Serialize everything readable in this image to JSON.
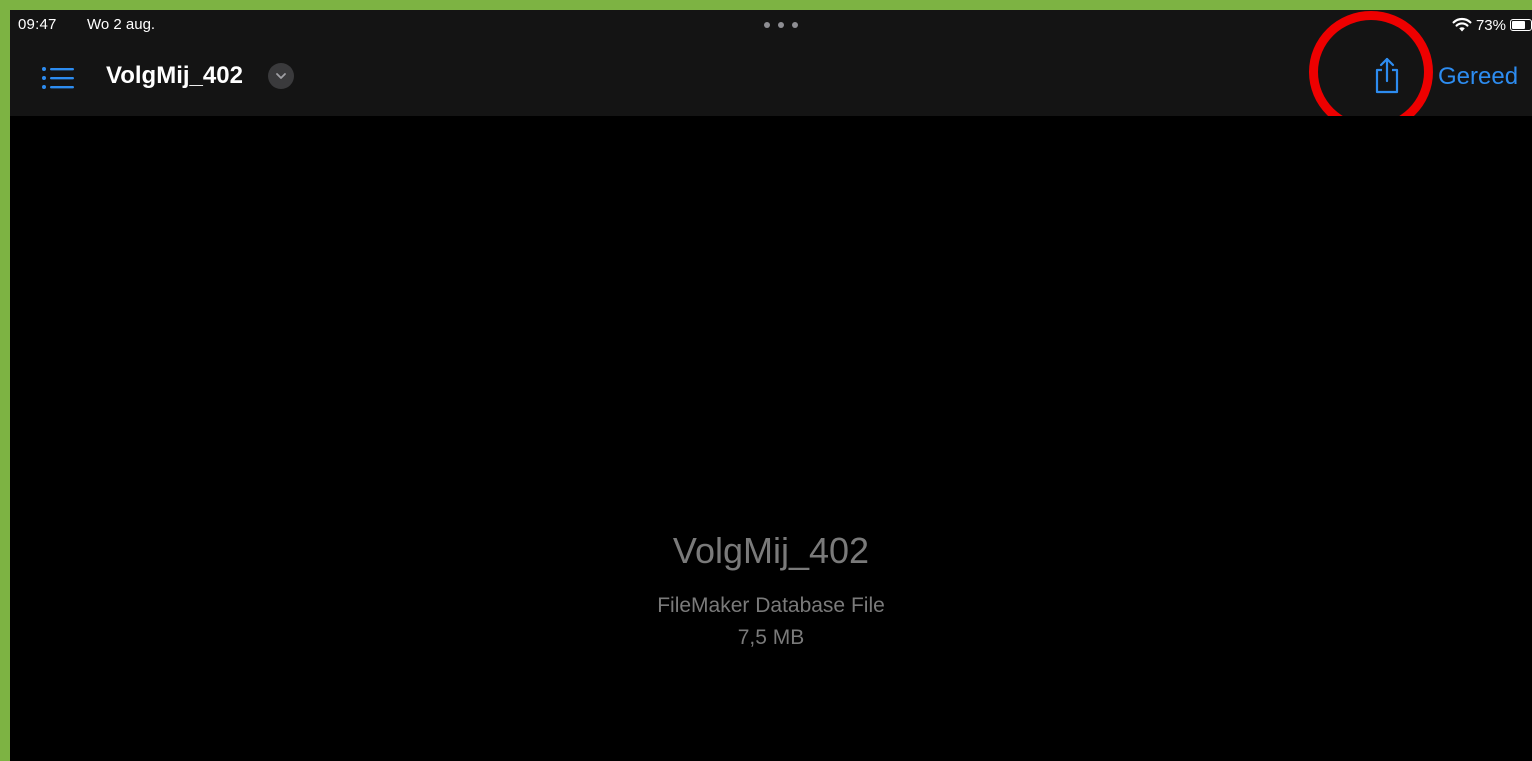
{
  "statusbar": {
    "time": "09:47",
    "date": "Wo 2 aug.",
    "battery_percent": "73%",
    "battery_level": 0.73,
    "wifi_icon": "wifi-icon",
    "multitask_icon": "ellipsis-dots-icon"
  },
  "navbar": {
    "sidebar_icon": "list-icon",
    "title": "VolgMij_402",
    "title_menu_icon": "chevron-down-icon",
    "share_icon": "share-icon",
    "done_label": "Gereed",
    "accent_color": "#2d8cf0"
  },
  "preview": {
    "file_name": "VolgMij_402",
    "file_type": "FileMaker Database File",
    "file_size": "7,5 MB"
  },
  "annotation": {
    "color": "#ee0000",
    "target": "share-button"
  }
}
